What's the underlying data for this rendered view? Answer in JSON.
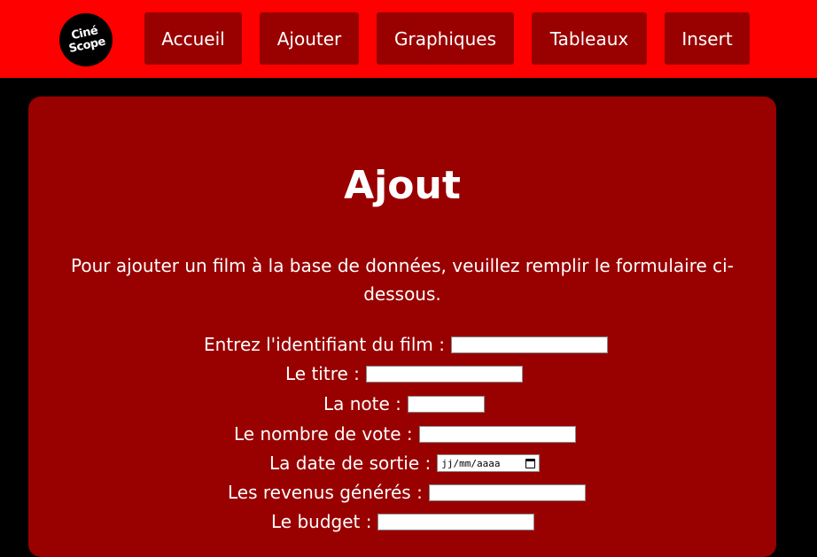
{
  "header": {
    "logo": {
      "line1": "Ciné",
      "line2": "Scope"
    },
    "nav": [
      {
        "label": "Accueil"
      },
      {
        "label": "Ajouter"
      },
      {
        "label": "Graphiques"
      },
      {
        "label": "Tableaux"
      },
      {
        "label": "Insert"
      }
    ]
  },
  "main": {
    "title": "Ajout",
    "intro": "Pour ajouter un film à la base de données, veuillez remplir le formulaire ci-dessous.",
    "form": {
      "id_label": "Entrez l'identifiant du film :",
      "title_label": "Le titre :",
      "note_label": "La note :",
      "votes_label": "Le nombre de vote :",
      "date_label": "La date de sortie :",
      "date_placeholder": "jj/mm/aaaa",
      "revenue_label": "Les revenus générés :",
      "budget_label": "Le budget :"
    }
  },
  "colors": {
    "topbar": "#ff0000",
    "button": "#990000",
    "panel": "#990000",
    "background": "#000000"
  }
}
